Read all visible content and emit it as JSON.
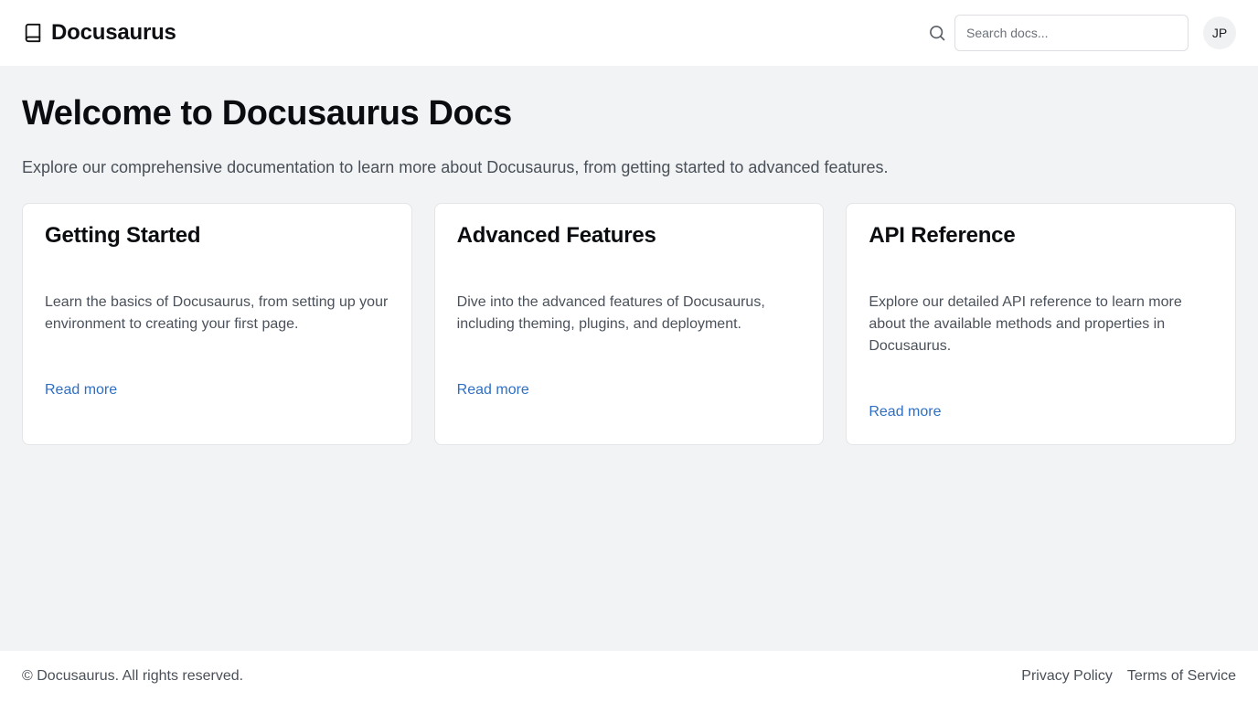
{
  "header": {
    "brand": "Docusaurus",
    "brand_icon": "book-icon",
    "search_icon": "search-icon",
    "search_placeholder": "Search docs...",
    "avatar_initials": "JP"
  },
  "main": {
    "title": "Welcome to Docusaurus Docs",
    "subtitle": "Explore our comprehensive documentation to learn more about Docusaurus, from getting started to advanced features.",
    "cards": [
      {
        "title": "Getting Started",
        "description": "Learn the basics of Docusaurus, from setting up your environment to creating your first page.",
        "link": "Read more"
      },
      {
        "title": "Advanced Features",
        "description": "Dive into the advanced features of Docusaurus, including theming, plugins, and deployment.",
        "link": "Read more"
      },
      {
        "title": "API Reference",
        "description": "Explore our detailed API reference to learn more about the available methods and properties in Docusaurus.",
        "link": "Read more"
      }
    ]
  },
  "footer": {
    "copyright": "© Docusaurus. All rights reserved.",
    "links": [
      "Privacy Policy",
      "Terms of Service"
    ]
  },
  "colors": {
    "background": "#f2f3f5",
    "surface": "#ffffff",
    "link": "#2f6fc3",
    "text_muted": "#4a5058"
  }
}
